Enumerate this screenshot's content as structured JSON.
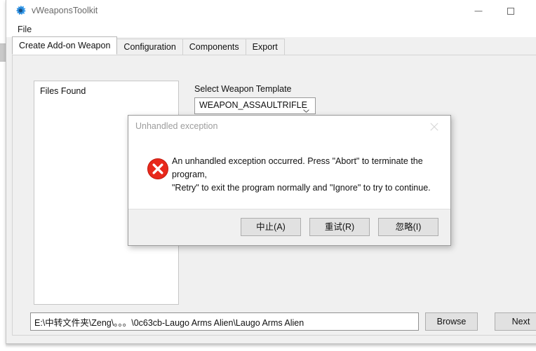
{
  "window": {
    "title": "vWeaponsToolkit",
    "icon": "gear-icon",
    "controls": {
      "minimize": "minimize-icon",
      "maximize": "maximize-icon"
    }
  },
  "menubar": {
    "items": [
      {
        "label": "File"
      }
    ]
  },
  "tabs": [
    {
      "label": "Create Add-on Weapon",
      "active": true
    },
    {
      "label": "Configuration",
      "active": false
    },
    {
      "label": "Components",
      "active": false
    },
    {
      "label": "Export",
      "active": false
    }
  ],
  "main": {
    "files_listbox": {
      "label": "Files Found",
      "items": []
    },
    "template": {
      "label": "Select Weapon Template",
      "selected": "WEAPON_ASSAULTRIFLE",
      "options": [
        "WEAPON_ASSAULTRIFLE"
      ]
    },
    "path": {
      "value": "E:\\中转文件夹\\Zeng\\。。。\\0c63cb-Laugo Arms Alien\\Laugo Arms Alien",
      "placeholder": ""
    },
    "browse_label": "Browse",
    "next_label": "Next"
  },
  "dialog": {
    "title": "Unhandled exception",
    "close_icon": "close-icon",
    "error_icon": "error-circle-x-icon",
    "message": "An unhandled exception occurred. Press \"Abort\" to terminate the program,\n\"Retry\" to exit the program normally and \"Ignore\" to try to continue.",
    "buttons": [
      {
        "label": "中止(A)"
      },
      {
        "label": "重试(R)"
      },
      {
        "label": "忽略(I)"
      }
    ]
  },
  "colors": {
    "error_red": "#e81123",
    "window_bg": "#f0f0f0",
    "accent": "#0078d7",
    "dialog_title_gray": "#9d9d9d"
  }
}
